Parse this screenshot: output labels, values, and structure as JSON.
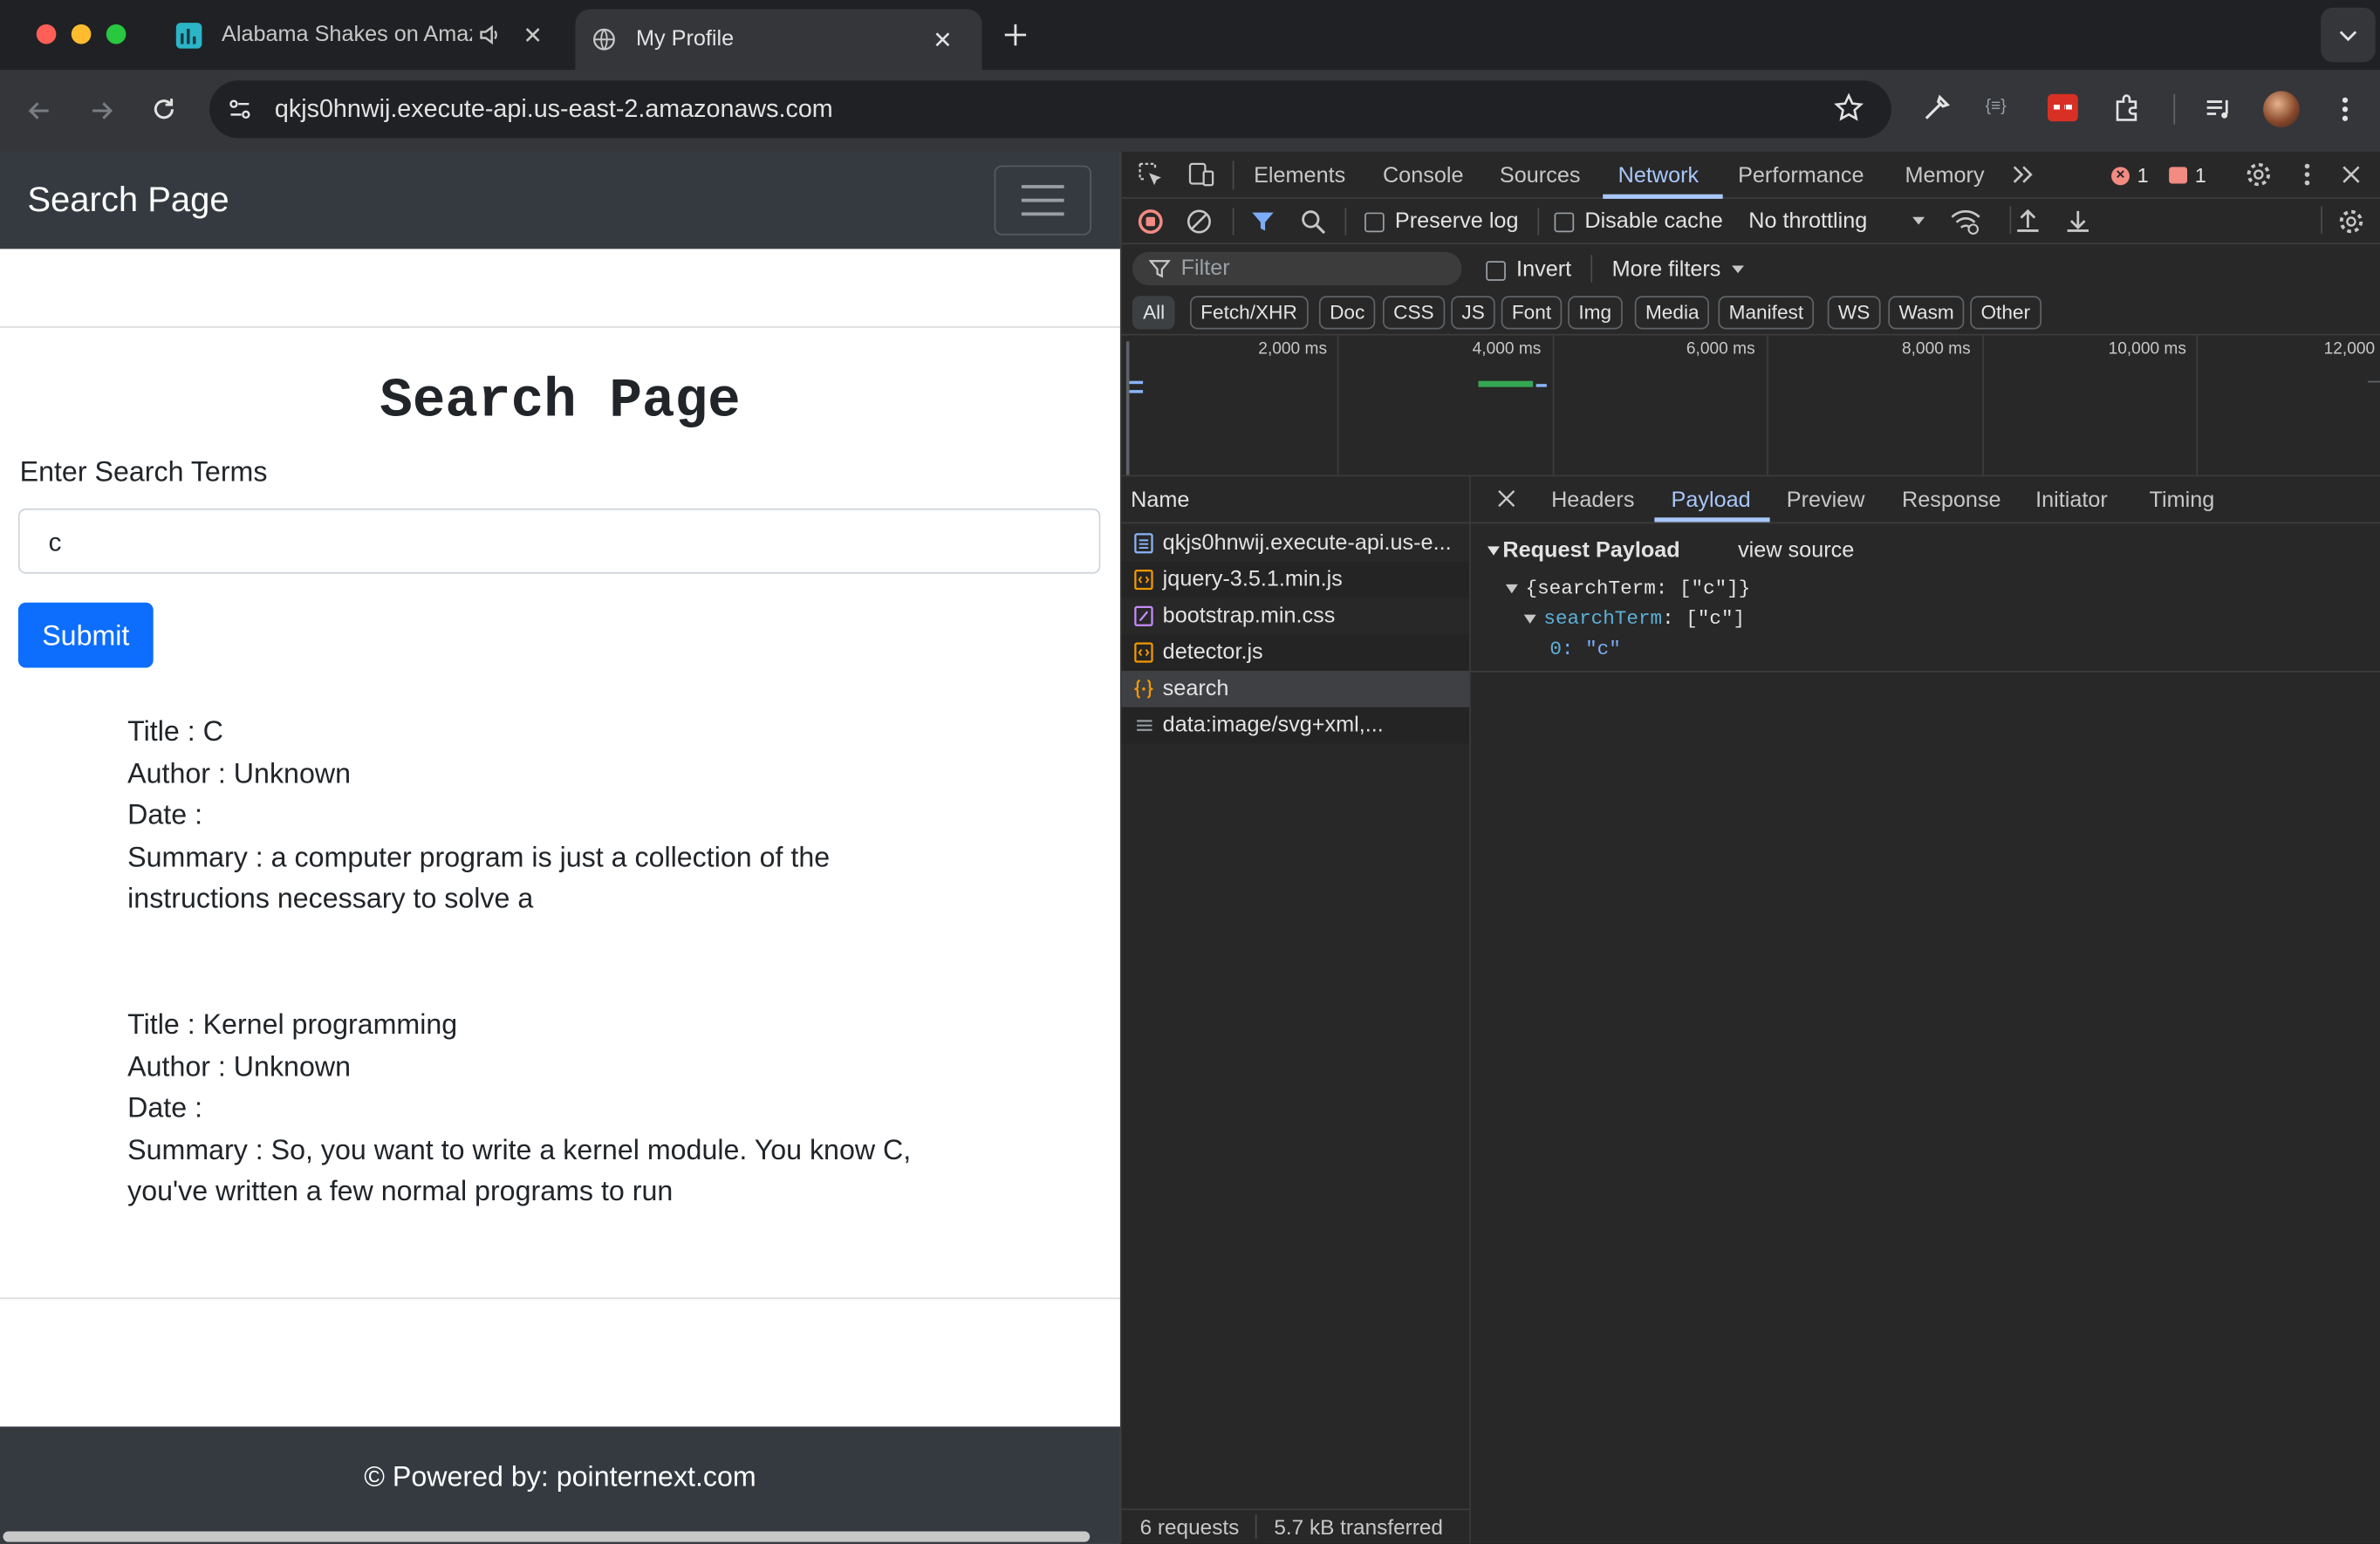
{
  "browser": {
    "tabs": [
      {
        "title": "Alabama Shakes on Amaz",
        "active": false
      },
      {
        "title": "My Profile",
        "active": true
      }
    ],
    "url": "qkjs0hnwij.execute-api.us-east-2.amazonaws.com"
  },
  "page": {
    "brand": "Search Page",
    "heading": "Search Page",
    "search_label": "Enter Search Terms",
    "search_value": "c",
    "submit_label": "Submit",
    "results": [
      {
        "title": "Title : C",
        "author": "Author : Unknown",
        "date": "Date :",
        "summary1": "Summary : a computer program is just a collection of the",
        "summary2": "instructions necessary to solve a"
      },
      {
        "title": "Title : Kernel programming",
        "author": "Author : Unknown",
        "date": "Date :",
        "summary1": "Summary : So, you want to write a kernel module. You know C,",
        "summary2": "you've written a few normal programs to run"
      }
    ],
    "footer": "© Powered by: pointernext.com"
  },
  "devtools": {
    "tabs": [
      "Elements",
      "Console",
      "Sources",
      "Network",
      "Performance",
      "Memory"
    ],
    "active_tab": "Network",
    "errors": "1",
    "warnings": "1",
    "toolbar": {
      "preserve_log": "Preserve log",
      "disable_cache": "Disable cache",
      "throttling": "No throttling"
    },
    "filter_placeholder": "Filter",
    "invert": "Invert",
    "more_filters": "More filters",
    "type_filters": [
      "All",
      "Fetch/XHR",
      "Doc",
      "CSS",
      "JS",
      "Font",
      "Img",
      "Media",
      "Manifest",
      "WS",
      "Wasm",
      "Other"
    ],
    "timeline_ticks": [
      "2,000 ms",
      "4,000 ms",
      "6,000 ms",
      "8,000 ms",
      "10,000 ms",
      "12,000"
    ],
    "name_header": "Name",
    "requests": [
      {
        "name": "qkjs0hnwij.execute-api.us-e...",
        "icon": "doc",
        "color": "#8ab4f8"
      },
      {
        "name": "jquery-3.5.1.min.js",
        "icon": "script",
        "color": "#f29900"
      },
      {
        "name": "bootstrap.min.css",
        "icon": "stylesheet",
        "color": "#c58af9"
      },
      {
        "name": "detector.js",
        "icon": "script",
        "color": "#f29900"
      },
      {
        "name": "search",
        "icon": "fetch",
        "color": "#f29900"
      },
      {
        "name": "data:image/svg+xml,...",
        "icon": "other",
        "color": "#9aa0a6"
      }
    ],
    "selected_request": "search",
    "detail_tabs": [
      "Headers",
      "Payload",
      "Preview",
      "Response",
      "Initiator",
      "Timing"
    ],
    "active_detail_tab": "Payload",
    "payload": {
      "section_title": "Request Payload",
      "view_source": "view source",
      "root": "{searchTerm: [\"c\"]}",
      "key": "searchTerm",
      "key_value": ": [\"c\"]",
      "index": "0",
      "index_value": ": \"c\""
    },
    "status": {
      "requests": "6 requests",
      "transferred": "5.7 kB transferred"
    }
  }
}
